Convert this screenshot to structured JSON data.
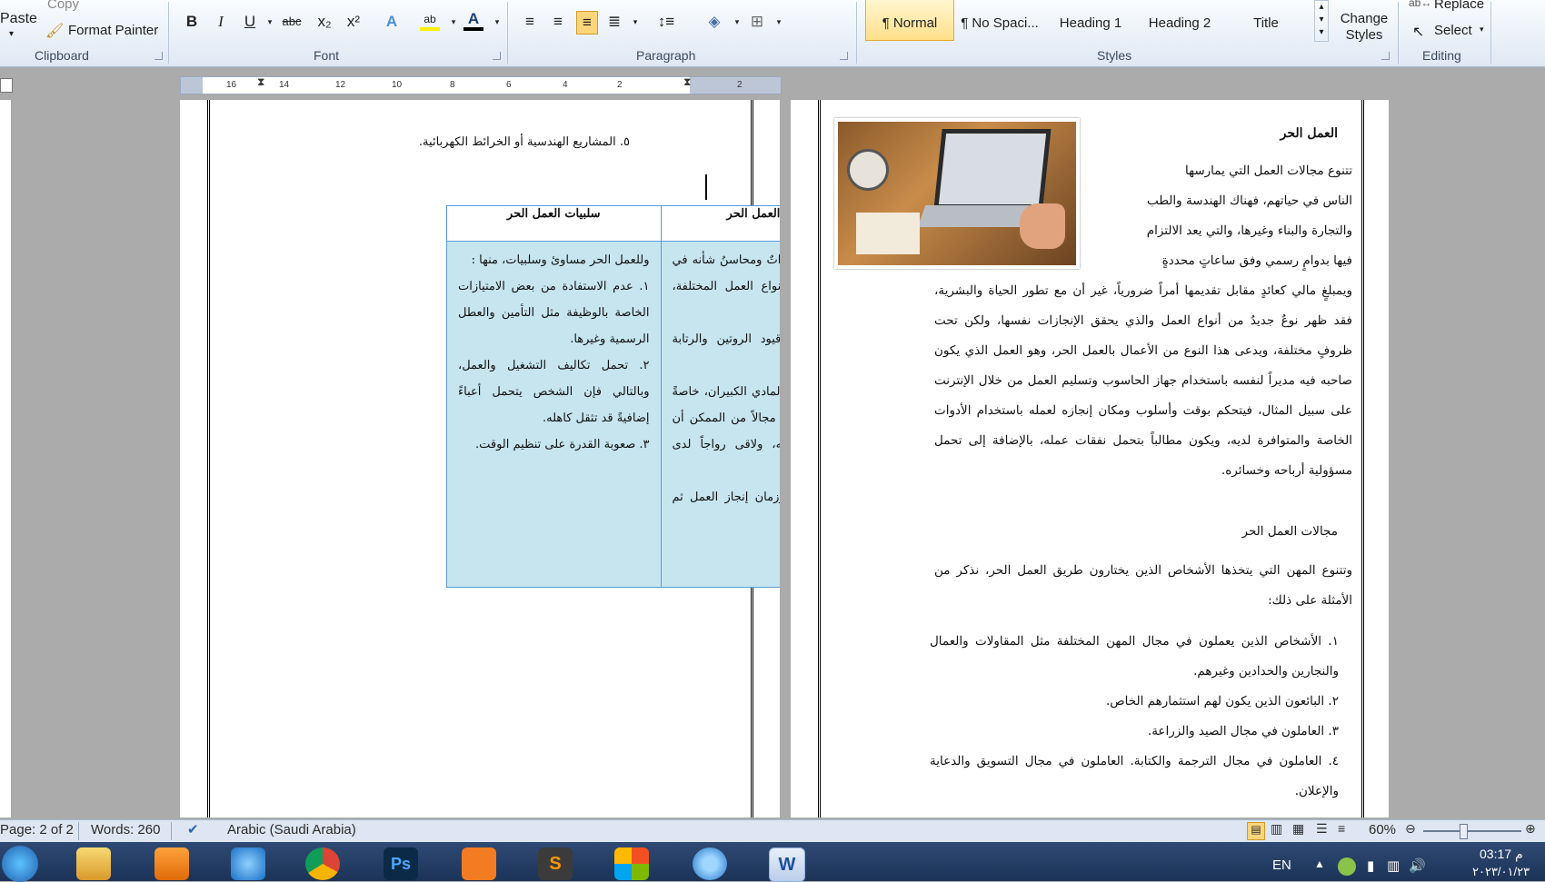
{
  "ribbon": {
    "clipboard": {
      "paste": "Paste",
      "copy": "Copy",
      "format_painter": "Format Painter",
      "label": "Clipboard"
    },
    "font": {
      "label": "Font",
      "bold": "B",
      "italic": "I",
      "underline": "U",
      "strike": "abc",
      "subscript": "x₂",
      "superscript": "x²"
    },
    "paragraph": {
      "label": "Paragraph"
    },
    "styles": {
      "label": "Styles",
      "items": [
        "¶ Normal",
        "¶ No Spaci...",
        "Heading 1",
        "Heading 2",
        "Title"
      ],
      "change_styles": "Change Styles"
    },
    "editing": {
      "label": "Editing",
      "replace": "Replace",
      "select": "Select"
    }
  },
  "ruler": {
    "ticks": [
      "16",
      "14",
      "12",
      "10",
      "8",
      "6",
      "4",
      "2",
      "2"
    ]
  },
  "left_page": {
    "top_line": "٥. المشاريع الهندسية أو الخرائط الكهربائية.",
    "table": {
      "headers": [
        "فوائد العمل الحر",
        "سلبيات العمل الحر"
      ],
      "benefits": "للعمل الحر مميزاتٌ ومحاسنُ شأنه في ذلك شأن كل أنواع العمل المختلفة، مثل :\n١. التحرر من قيود الروتين والرتابة الخاصة بالوظيفة.\n٢. الربح والعائد المادي الكبيران، خاصةً إذا اختار الإنسان مجالاً من الممكن أن يبدع ويتفوق فيه، ولاقى رواجاً لدى الطرف المقابل.\n٣. حرية مكان وزمان إنجاز العمل ثم تسليمه.",
      "drawbacks": "وللعمل الحر مساوئ وسلبيات، منها :\n١. عدم الاستفادة من بعض الامتيازات الخاصة بالوظيفة مثل التأمين والعطل الرسمية وغيرها.\n٢. تحمل تكاليف التشغيل والعمل، وبالتالي فإن الشخص يتحمل أعباءً إضافيةً قد تثقل كاهله.\n٣. صعوبة القدرة على تنظيم الوقت."
    }
  },
  "right_page": {
    "heading1": "العمل الحر",
    "intro_lines": [
      "تتنوع مجالات العمل التي يمارسها",
      "الناس في حياتهم، فهناك الهندسة والطب",
      "والتجارة والبناء وغيرها، والتي يعد الالتزام",
      "فيها بدوامٍ رسمي وفق ساعاتٍ محددةٍ"
    ],
    "body": "ويمبلغٍ مالي كعائدٍ مقابل تقديمها أمراً ضرورياً، غير أن مع تطور الحياة والبشرية، فقد ظهر نوعٌ جديدٌ من أنواع العمل والذي يحقق الإنجازات نفسها، ولكن تحت ظروفٍ مختلفة، ويدعى هذا النوع من الأعمال بالعمل الحر، وهو العمل الذي يكون صاحبه فيه مديراً لنفسه باستخدام جهاز الحاسوب وتسليم العمل من خلال الإنترنت على سبيل المثال، فيتحكم بوقت وأسلوب ومكان إنجازه لعمله باستخدام الأدوات الخاصة والمتوافرة لديه، ويكون مطالباً بتحمل نفقات عمله، بالإضافة إلى تحمل مسؤولية أرباحه وخسائره.",
    "heading2": "مجالات العمل الحر",
    "para2": "وتتنوع المهن التي يتخذها الأشخاص الذين يختارون طريق العمل الحر، نذكر من الأمثلة على ذلك:",
    "list": [
      "١. الأشخاص الذين يعملون في مجال المهن المختلفة مثل المقاولات والعمال والنجارين والحدادين وغيرهم.",
      "٢. البائعون الذين يكون لهم استثمارهم الخاص.",
      "٣. العاملون في مجال الصيد والزراعة.",
      "٤. العاملون في مجال الترجمة والكتابة. العاملون في مجال التسويق والدعاية والإعلان."
    ]
  },
  "status_bar": {
    "page": "Page: 2 of 2",
    "words": "Words: 260",
    "language": "Arabic (Saudi Arabia)",
    "zoom": "60%"
  },
  "taskbar": {
    "lang": "EN",
    "time": "03:17 م",
    "date": "٢٠٢٣/٠١/٢٣"
  },
  "colors": {
    "table_fill": "#c6e5ef",
    "table_border": "#5a9bd5",
    "heading_fill": "#d9d9d9"
  }
}
